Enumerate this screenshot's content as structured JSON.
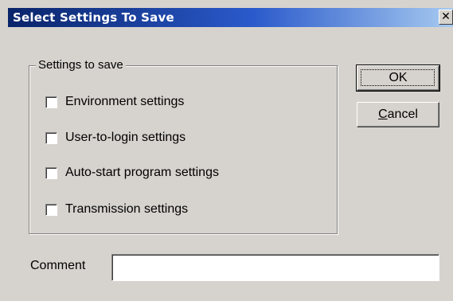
{
  "window": {
    "title": "Select  Settings To Save",
    "close_glyph": "✕"
  },
  "settings_group": {
    "legend": "Settings to save",
    "items": [
      {
        "label": "Environment settings",
        "checked": false
      },
      {
        "label": "User-to-login settings",
        "checked": false
      },
      {
        "label": "Auto-start program settings",
        "checked": false
      },
      {
        "label": "Transmission settings",
        "checked": false
      }
    ]
  },
  "buttons": {
    "ok_label": "OK",
    "cancel_prefix": "C",
    "cancel_rest": "ancel"
  },
  "comment": {
    "label": "Comment",
    "value": ""
  }
}
